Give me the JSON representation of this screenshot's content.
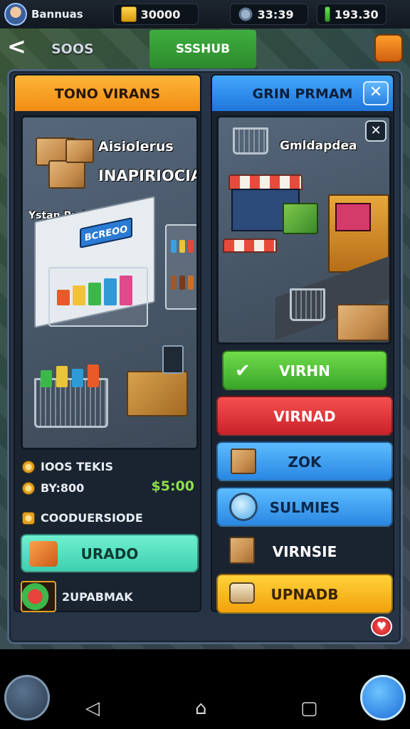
{
  "topbar": {
    "player_name": "Bannuas",
    "gold": "30000",
    "gears": "33:39",
    "gems": "193.30"
  },
  "nav": {
    "back_symbol": "<",
    "breadcrumb": "SOOS",
    "center_tab": "SSSHUB"
  },
  "left_panel": {
    "header": "TONO VIRANS",
    "art_title_1": "Aisiolerus",
    "art_title_2": "INAPIRIOCIA",
    "art_subtitle": "Ystan Prahese",
    "sign_text": "BCREOO",
    "stat_1": "IOOS TEKIS",
    "stat_2": "BY:800",
    "price": "$5:00",
    "section_label": "COODUERSIODE",
    "upgrade_button": "URADO",
    "extra_item": "2UPABMAK"
  },
  "right_panel": {
    "header": "GRIN PRMAM",
    "art_title": "Gmldapdea",
    "buttons": {
      "green": "VIRHN",
      "red": "VIRNAD",
      "blue_1": "ZOK",
      "blue_2": "SULMIES",
      "plain": "VIRNSIE",
      "yellow": "UPNADB"
    }
  },
  "colors": {
    "orange_header": "#f5a020",
    "blue_header": "#2f8ef0",
    "price_green": "#8de04a",
    "teal_button": "#4fdcbc"
  }
}
